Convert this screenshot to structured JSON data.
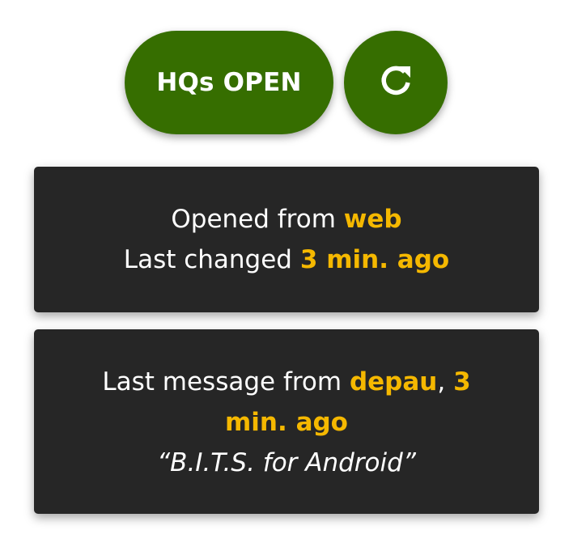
{
  "status_button": {
    "label": "HQs OPEN",
    "color": "#366e00"
  },
  "refresh_button": {
    "icon": "refresh-icon"
  },
  "status_card": {
    "opened_prefix": "Opened from ",
    "opened_source": "web",
    "changed_prefix": "Last changed ",
    "changed_time": "3 min. ago"
  },
  "message_card": {
    "prefix": "Last message from ",
    "user": "depau",
    "separator": ", ",
    "time": "3 min. ago",
    "text": "“B.I.T.S. for Android”"
  },
  "colors": {
    "accent": "#f5b800",
    "card_background": "#262626",
    "button_green": "#366e00"
  }
}
